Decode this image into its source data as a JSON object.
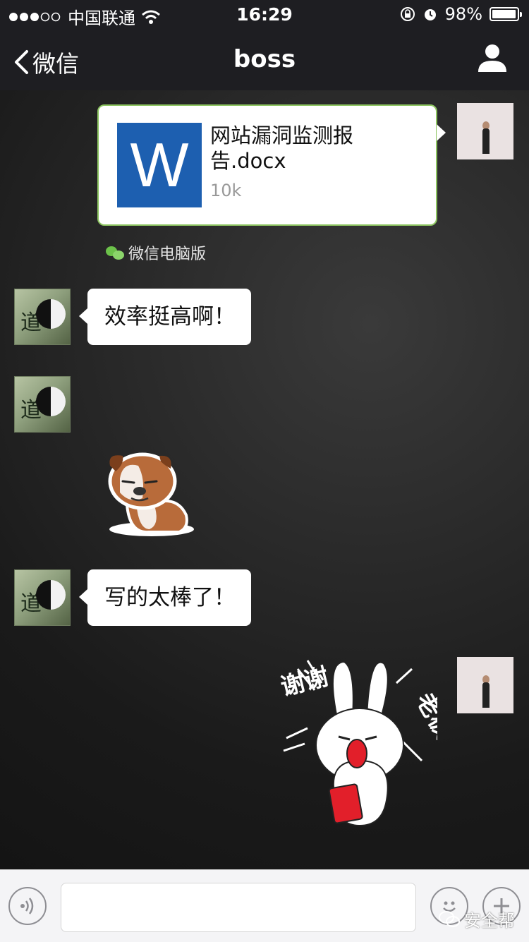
{
  "status_bar": {
    "carrier": "中国联通",
    "time": "16:29",
    "battery_text": "98%",
    "battery_level": 0.98,
    "signal_icon": "signal-dots-icon",
    "wifi_icon": "wifi-icon"
  },
  "nav": {
    "back_label": "微信",
    "title": "boss",
    "profile_icon": "person-icon"
  },
  "messages": [
    {
      "type": "file",
      "from": "me",
      "file_name": "网站漏洞监测报告.docx",
      "file_size": "10k",
      "file_icon": "word-document-icon"
    },
    {
      "type": "source",
      "text": "微信电脑版"
    },
    {
      "type": "text",
      "from": "boss",
      "text": "效率挺高啊！"
    },
    {
      "type": "sticker",
      "from": "boss",
      "sticker": "bulldog-sticker"
    },
    {
      "type": "text",
      "from": "boss",
      "text": "写的太棒了！"
    },
    {
      "type": "sticker",
      "from": "me",
      "sticker": "rabbit-thanks-boss-sticker",
      "sticker_text_left": "谢谢",
      "sticker_text_right": "老板"
    }
  ],
  "avatars": {
    "boss_char": "道"
  },
  "input_bar": {
    "voice_icon": "voice-icon",
    "emoji_icon": "emoji-icon",
    "plus_icon": "plus-icon",
    "watermark": "安全帮"
  },
  "colors": {
    "header_bg": "#1e1e22",
    "file_border": "#8dc561",
    "word_blue": "#1d5fb0",
    "wechat_green": "#6cc24a"
  }
}
